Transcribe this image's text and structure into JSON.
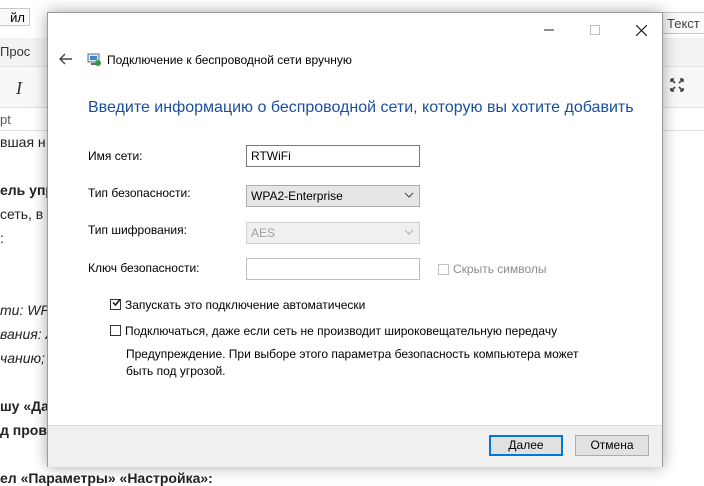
{
  "background": {
    "tab_left": "йл",
    "tab_right": "Текст",
    "menu_left": "Прос",
    "italic_btn": "I",
    "path_text": "pt",
    "lines": [
      {
        "text": "вшая н",
        "style": ""
      },
      {
        "text": "ель упр",
        "style": "b"
      },
      {
        "text": "сеть, в",
        "style": ""
      },
      {
        "text": ":",
        "style": ""
      },
      {
        "text": "ти: WPA",
        "style": "i"
      },
      {
        "text": "вания: A",
        "style": "i"
      },
      {
        "text": "чанию;",
        "style": "i"
      },
      {
        "text": "шу «Да",
        "style": "b"
      },
      {
        "text": "д прово",
        "style": "b"
      },
      {
        "text": "ел «Параметры» «Настройка»:",
        "style": "b"
      }
    ]
  },
  "dialog": {
    "window_controls": {
      "minimize": "—",
      "maximize": "☐",
      "close": "✕"
    },
    "title": "Подключение к беспроводной сети вручную",
    "heading": "Введите информацию о беспроводной сети, которую вы хотите добавить",
    "network_name": {
      "label": "Имя сети:",
      "value": "RTWiFi"
    },
    "security_type": {
      "label": "Тип безопасности:",
      "value": "WPA2-Enterprise"
    },
    "encryption_type": {
      "label": "Тип шифрования:",
      "value": "AES"
    },
    "security_key": {
      "label": "Ключ безопасности:",
      "value": "",
      "hide_chars_label": "Скрыть символы",
      "hide_chars_checked": false
    },
    "auto_connect": {
      "label": "Запускать это подключение автоматически",
      "checked": true
    },
    "connect_hidden": {
      "label": "Подключаться, даже если сеть не производит широковещательную передачу",
      "checked": false
    },
    "warning": "Предупреждение. При выборе этого параметра безопасность компьютера может быть под угрозой.",
    "buttons": {
      "next": "Далее",
      "cancel": "Отмена"
    }
  },
  "colors": {
    "heading": "#1a4f9c",
    "primary_border": "#0078d7"
  }
}
